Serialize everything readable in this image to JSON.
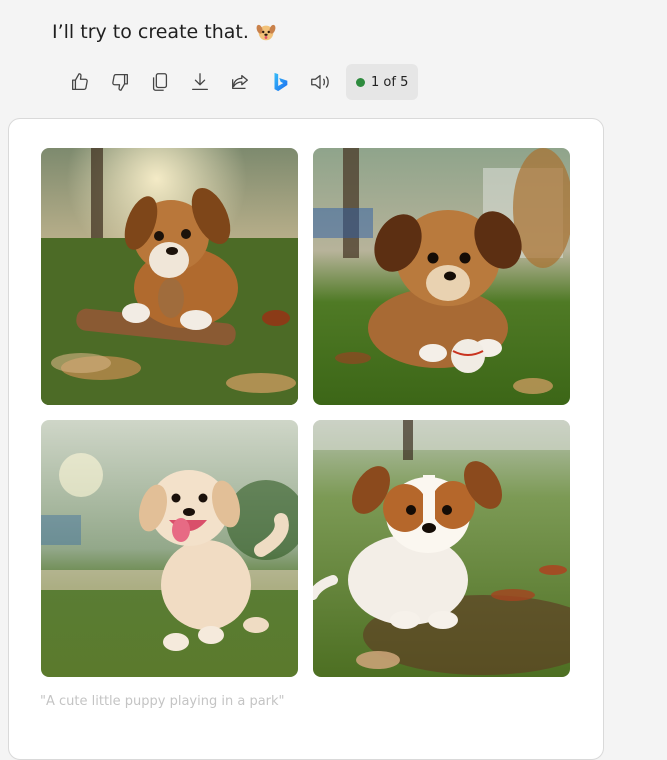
{
  "message": {
    "text": "I’ll try to create that.",
    "emoji_icon": "dog-face-icon"
  },
  "actions": [
    {
      "name": "like-button",
      "icon": "thumbs-up-icon"
    },
    {
      "name": "dislike-button",
      "icon": "thumbs-down-icon"
    },
    {
      "name": "copy-button",
      "icon": "copy-icon"
    },
    {
      "name": "download-button",
      "icon": "download-icon"
    },
    {
      "name": "share-button",
      "icon": "share-icon"
    },
    {
      "name": "bing-button",
      "icon": "bing-logo-icon"
    },
    {
      "name": "read-aloud-button",
      "icon": "speaker-icon"
    }
  ],
  "pager": {
    "label": "1 of 5",
    "status_color": "#2e8b3e"
  },
  "images": [
    {
      "name": "puppy-image-1"
    },
    {
      "name": "puppy-image-2"
    },
    {
      "name": "puppy-image-3"
    },
    {
      "name": "puppy-image-4"
    }
  ],
  "caption": "\"A cute little puppy playing in a park\""
}
